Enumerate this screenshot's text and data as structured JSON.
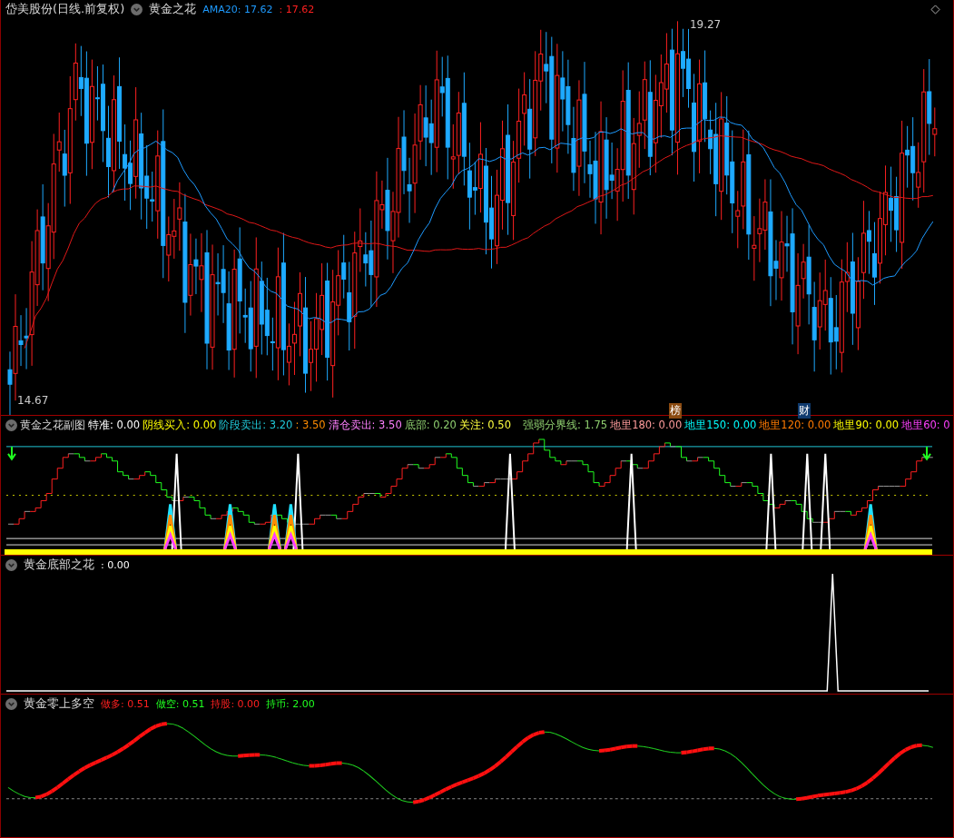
{
  "main_panel": {
    "title": "岱美股份(日线.前复权)",
    "indicator_name": "黄金之花",
    "legend": [
      {
        "text": "AMA20: 17.62",
        "color": "#1e9bff"
      },
      {
        "text": ": 17.62",
        "color": "#ff2020"
      }
    ],
    "high_mark": "19.27",
    "low_mark": "14.67",
    "badges": [
      {
        "text": "榜",
        "color": "#8a4a10"
      },
      {
        "text": "财",
        "color": "#0f3a6e"
      }
    ]
  },
  "sub_panel": {
    "title": "黄金之花副图",
    "legend": [
      {
        "text": "特准: 0.00",
        "color": "#ffffff"
      },
      {
        "text": "阴线买入: 0.00",
        "color": "#ffff00"
      },
      {
        "text": "阶段卖出: 3.20",
        "color": "#20c8d8"
      },
      {
        "text": ": 3.50",
        "color": "#ff8c00"
      },
      {
        "text": "清仓卖出: 3.50",
        "color": "#ff80ff"
      },
      {
        "text": "底部: 0.20",
        "color": "#90d070"
      },
      {
        "text": "关注: 0.50",
        "color": "#ffff40"
      },
      {
        "text": "强弱分界线: 1.75",
        "color": "#90d070"
      },
      {
        "text": "地里180: 0.00",
        "color": "#ff9c9c"
      },
      {
        "text": "地里150: 0.00",
        "color": "#00ffff"
      },
      {
        "text": "地里120: 0.00",
        "color": "#ff7a00"
      },
      {
        "text": "地里90: 0.00",
        "color": "#ffff00"
      },
      {
        "text": "地里60: 0",
        "color": "#ff40ff"
      }
    ]
  },
  "bottom_panel": {
    "title": "黄金底部之花",
    "legend": [
      {
        "text": ": 0.00",
        "color": "#ffffff"
      }
    ]
  },
  "oscillator_panel": {
    "title": "黄金零上多空",
    "legend": [
      {
        "text": "做多: 0.51",
        "color": "#ff2020"
      },
      {
        "text": "做空: 0.51",
        "color": "#20ff20"
      },
      {
        "text": "持股: 0.00",
        "color": "#ff2020"
      },
      {
        "text": "持币: 2.00",
        "color": "#20ff20"
      }
    ]
  }
}
